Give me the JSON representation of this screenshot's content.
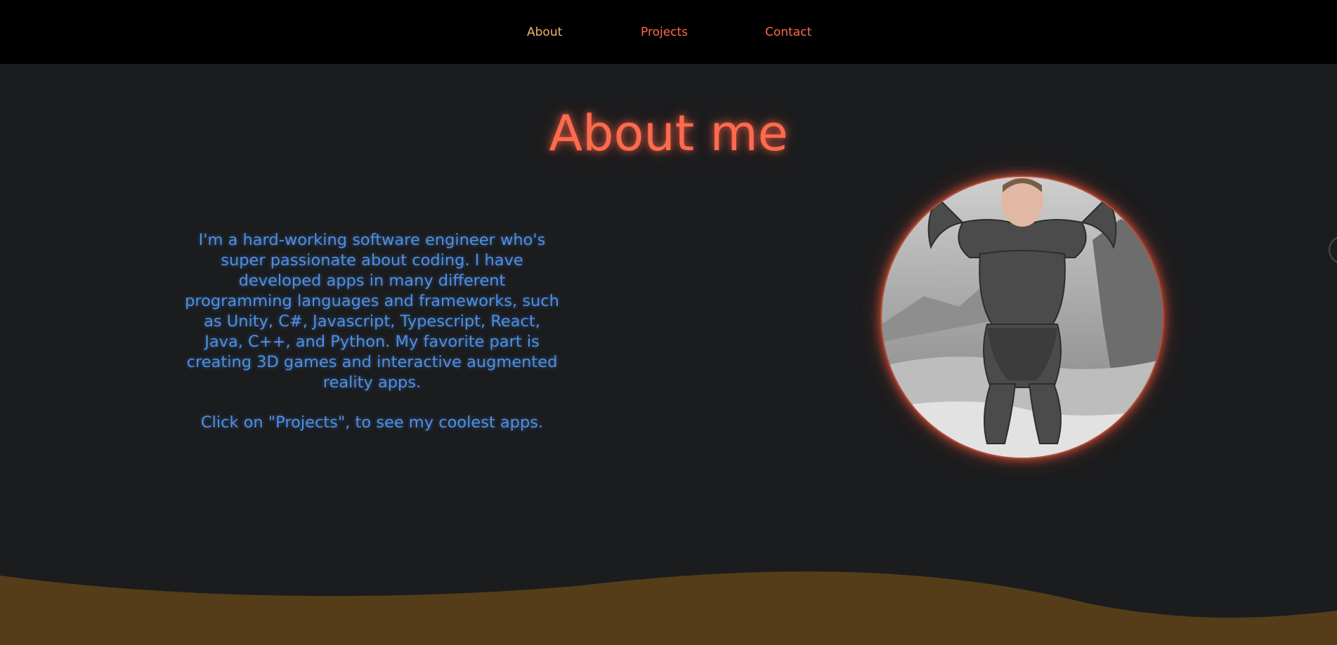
{
  "nav": {
    "items": [
      {
        "label": "About"
      },
      {
        "label": "Projects"
      },
      {
        "label": "Contact"
      }
    ]
  },
  "about": {
    "title": "About me",
    "paragraph": "I'm a hard-working software engineer who's super passionate about coding. I have developed apps in many different programming languages and frameworks, such as Unity, C#, Javascript, Typescript, React, Java, C++, and Python. My favorite part is creating 3D games and interactive augmented reality apps.",
    "cta": "Click on \"Projects\", to see my coolest apps."
  },
  "colors": {
    "page_background": "#1b1c1e",
    "navbar_background": "#000000",
    "nav_active": "#f2b36b",
    "nav_link": "#ff6a4d",
    "title": "#ff6a4d",
    "body_text": "#4d8fe6",
    "wave": "#553d19"
  },
  "images": {
    "portrait": "profile-photo"
  }
}
